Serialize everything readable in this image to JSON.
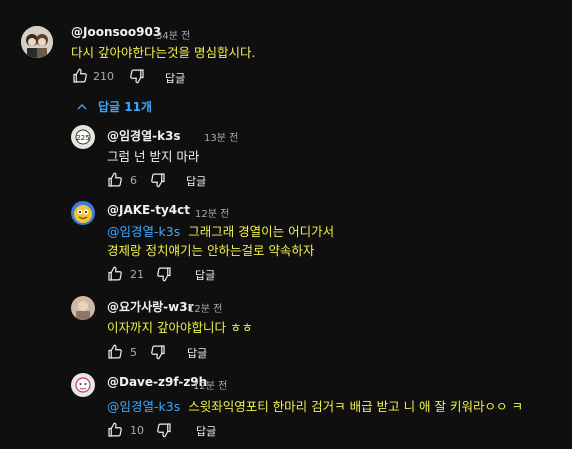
{
  "comments": [
    {
      "author": "@Joonsoo903",
      "time": "34분 전",
      "text": "다시 갚아야한다는것을 명심합시다.",
      "likes": "210",
      "reply_label": "답글"
    }
  ],
  "replies_toggle": {
    "label": "답글 11개",
    "icon": "chevron-up-icon"
  },
  "replies": [
    {
      "author": "@임경열-k3s",
      "time": "13분 전",
      "text": "그럼 넌 받지 마라",
      "likes": "6",
      "reply_label": "답글"
    },
    {
      "author": "@JAKE-ty4ct",
      "time": "12분 전",
      "mention": "@임경열-k3s",
      "text_line1": "그래그래 경열이는 어디가서",
      "text_line2": "경제랑 정치얘기는 안하는걸로 약속하자",
      "likes": "21",
      "reply_label": "답글"
    },
    {
      "author": "@요가사랑-w3r",
      "time": "12분 전",
      "text": "이자까지 갚아야합니다 ㅎㅎ",
      "likes": "5",
      "reply_label": "답글"
    },
    {
      "author": "@Dave-z9f-z9h",
      "time": "12분 전",
      "mention": "@임경열-k3s",
      "text": "스윗좌익영포티 한마리 검거ㅋ 배급 받고 니 애 잘 키워라ㅇㅇ ㅋ",
      "likes": "10",
      "reply_label": "답글"
    }
  ],
  "colors": {
    "background": "#0f0f0f",
    "mention": "#3ea6ff",
    "highlight_text": "#f3f14a"
  }
}
